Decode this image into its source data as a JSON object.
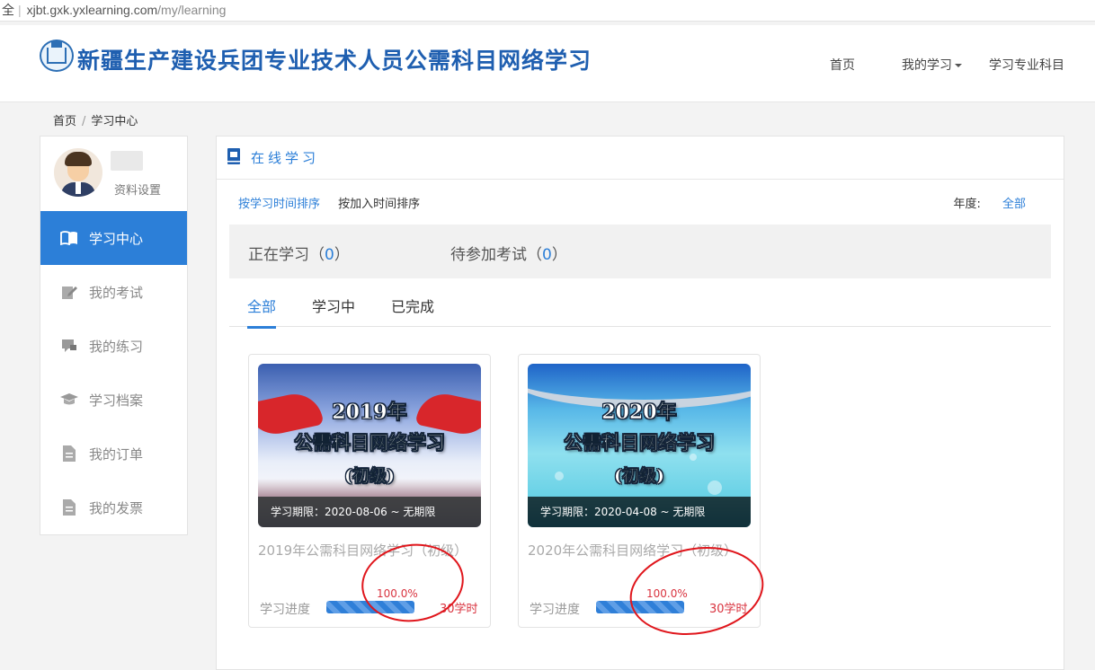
{
  "browser": {
    "security_label": "全",
    "url_host": "xjbt.gxk.yxlearning.com",
    "url_path": "/my/learning"
  },
  "header": {
    "site_title": "新疆生产建设兵团专业技术人员公需科目网络学习",
    "nav": {
      "home": "首页",
      "my_learning": "我的学习",
      "courses": "学习专业科目"
    }
  },
  "breadcrumb": {
    "home": "首页",
    "current": "学习中心"
  },
  "sidebar": {
    "profile_link": "资料设置",
    "items": [
      {
        "label": "学习中心",
        "icon": "book-open-icon"
      },
      {
        "label": "我的考试",
        "icon": "edit-icon"
      },
      {
        "label": "我的练习",
        "icon": "chat-icon"
      },
      {
        "label": "学习档案",
        "icon": "graduation-cap-icon"
      },
      {
        "label": "我的订单",
        "icon": "document-icon"
      },
      {
        "label": "我的发票",
        "icon": "document-icon"
      }
    ]
  },
  "content": {
    "panel_title": "在线学习",
    "sort": {
      "by_study_time": "按学习时间排序",
      "by_join_time": "按加入时间排序"
    },
    "year": {
      "label": "年度:",
      "value": "全部"
    },
    "stats": {
      "studying_label": "正在学习（",
      "studying_count": "0",
      "exam_label": "待参加考试（",
      "exam_count": "0",
      "close": "）"
    },
    "tabs": [
      "全部",
      "学习中",
      "已完成"
    ],
    "courses": [
      {
        "cover_year": "2019年",
        "cover_subject": "公需科目网络学习",
        "cover_level": "(初级)",
        "period": "学习期限：2020-08-06 ~ 无期限",
        "title": "2019年公需科目网络学习（初级）",
        "progress_label": "学习进度",
        "progress": 1.0,
        "progress_text": "100.0%",
        "hours": "30学时"
      },
      {
        "cover_year": "2020年",
        "cover_subject": "公需科目网络学习",
        "cover_level": "(初级)",
        "period": "学习期限：2020-04-08 ~ 无期限",
        "title": "2020年公需科目网络学习（初级）",
        "progress_label": "学习进度",
        "progress": 1.0,
        "progress_text": "100.0%",
        "hours": "30学时"
      }
    ]
  },
  "colors": {
    "accent": "#2c7fd8",
    "alert": "#d9333f",
    "annotation": "#e0161c"
  }
}
